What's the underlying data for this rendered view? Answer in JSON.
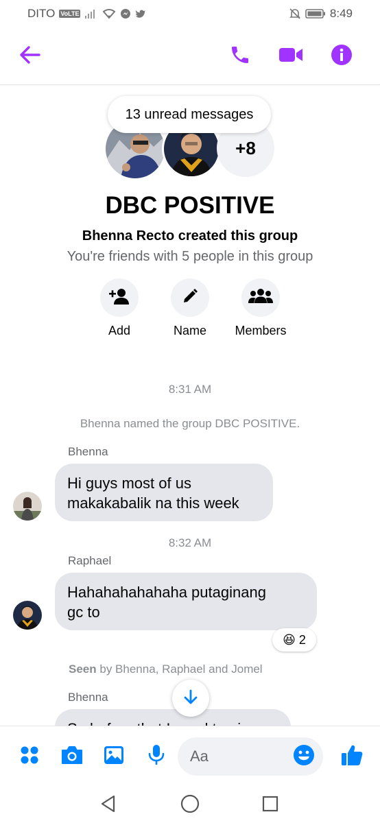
{
  "status_bar": {
    "carrier": "DITO",
    "volte": "VoLTE",
    "time": "8:49",
    "icons": [
      "signal-icon",
      "wifi-icon",
      "messenger-icon",
      "twitter-icon",
      "mute-bell-icon",
      "battery-icon"
    ]
  },
  "header": {
    "icons": [
      "back-arrow-icon",
      "phone-icon",
      "video-call-icon",
      "info-icon"
    ],
    "accent_color": "#a033ff"
  },
  "unread_pill": "13 unread messages",
  "group": {
    "extra_members": "+8",
    "name": "DBC POSITIVE",
    "created_by": "Bhenna Recto created this group",
    "friends_info": "You're friends with 5 people in this group"
  },
  "actions": [
    {
      "label": "Add",
      "icon": "add-person-icon"
    },
    {
      "label": "Name",
      "icon": "pencil-icon"
    },
    {
      "label": "Members",
      "icon": "members-icon"
    }
  ],
  "conversation": {
    "time_1": "8:31 AM",
    "system_message": "Bhenna named the group DBC POSITIVE.",
    "msg1_sender": "Bhenna",
    "msg1_line1": "Hi guys most of us",
    "msg1_line2": "makakabalik na this week",
    "time_2": "8:32 AM",
    "msg2_sender": "Raphael",
    "msg2_line1": "Hahahahahahaha putaginang",
    "msg2_line2": "gc to",
    "msg2_reaction_emoji": "😆",
    "msg2_reaction_count": "2",
    "seen_label": "Seen",
    "seen_names": " by Bhenna, Raphael and Jomel",
    "msg3_sender": "Bhenna",
    "msg3_partial": "So before that I need to give"
  },
  "composer": {
    "placeholder": "Aa",
    "icons": [
      "apps-icon",
      "camera-icon",
      "gallery-icon",
      "mic-icon",
      "emoji-icon",
      "thumbs-up-icon"
    ],
    "accent_color": "#0084ff"
  },
  "navbar": {
    "icons": [
      "back-triangle-icon",
      "home-circle-icon",
      "recents-square-icon"
    ]
  }
}
